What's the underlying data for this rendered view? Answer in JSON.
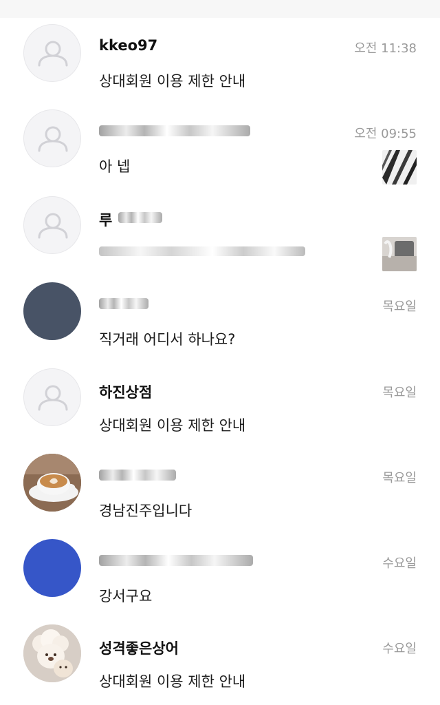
{
  "chats": [
    {
      "name": "kkeo97",
      "message": "상대회원 이용 제한 안내",
      "time": "오전 11:38",
      "avatar": "default-user-icon"
    },
    {
      "name": "",
      "message": "아 넵",
      "time": "오전 09:55",
      "avatar": "default-user-icon"
    },
    {
      "name": "루",
      "message": "",
      "time": "",
      "avatar": "default-user-icon"
    },
    {
      "name": "",
      "message": "직거래 어디서 하나요?",
      "time": "목요일",
      "avatar": "navy-avatar"
    },
    {
      "name": "하진상점",
      "message": "상대회원 이용 제한 안내",
      "time": "목요일",
      "avatar": "default-user-icon"
    },
    {
      "name": "",
      "message": "경남진주입니다",
      "time": "목요일",
      "avatar": "coffee-photo"
    },
    {
      "name": "",
      "message": "강서구요",
      "time": "수요일",
      "avatar": "blue-avatar"
    },
    {
      "name": "성격좋은상어",
      "message": "상대회원 이용 제한 안내",
      "time": "수요일",
      "avatar": "bear-photo"
    }
  ],
  "colors": {
    "time": "#9a9a9a",
    "avatar_default_bg": "#f4f4f6",
    "avatar_navy": "#485366",
    "avatar_blue": "#3656c8"
  }
}
